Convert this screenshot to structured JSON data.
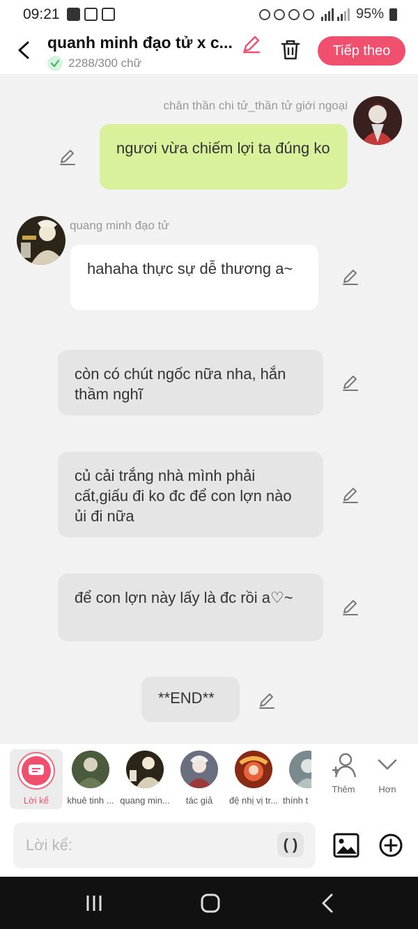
{
  "status_bar": {
    "time": "09:21",
    "battery": "95%",
    "icons": [
      "image-icon",
      "translate-icon",
      "youtube-icon",
      "alarm-icon",
      "mute-icon",
      "wifi-icon",
      "wifi-call-icon",
      "signal-icon",
      "signal-icon",
      "battery-icon"
    ]
  },
  "header": {
    "title": "quanh minh đạo tử x c...",
    "word_count": "2288/300 chữ",
    "next_label": "Tiếp theo",
    "accent": "#f0506e"
  },
  "messages": [
    {
      "speaker": "chân thần chi tử_thần tử giới ngoại",
      "text": "ngươi vừa chiếm lợi ta đúng ko",
      "style": "green"
    },
    {
      "speaker": "quang minh đạo tử",
      "text": "hahaha thực sự dễ thương a~",
      "style": "white"
    },
    {
      "text": "còn có chút ngốc nữa nha, hắn thầm nghĩ",
      "style": "narration"
    },
    {
      "text": "củ cải trắng nhà mình phải cất,giấu đi ko đc để con lợn nào ủi đi nữa",
      "style": "narration"
    },
    {
      "text": "để con lợn này lấy là đc rồi a♡~",
      "style": "narration"
    },
    {
      "text": "**END**",
      "style": "narration"
    }
  ],
  "characters": [
    {
      "label": "Lời kể",
      "selected": true
    },
    {
      "label": "khuê tinh ..."
    },
    {
      "label": "quang min..."
    },
    {
      "label": "tác giả"
    },
    {
      "label": "đệ nhị vị tr..."
    },
    {
      "label": "thính t"
    }
  ],
  "actions": {
    "add_label": "Thêm",
    "more_label": "Hơn"
  },
  "input": {
    "placeholder": "Lời kể:",
    "paren_label": "( )"
  }
}
